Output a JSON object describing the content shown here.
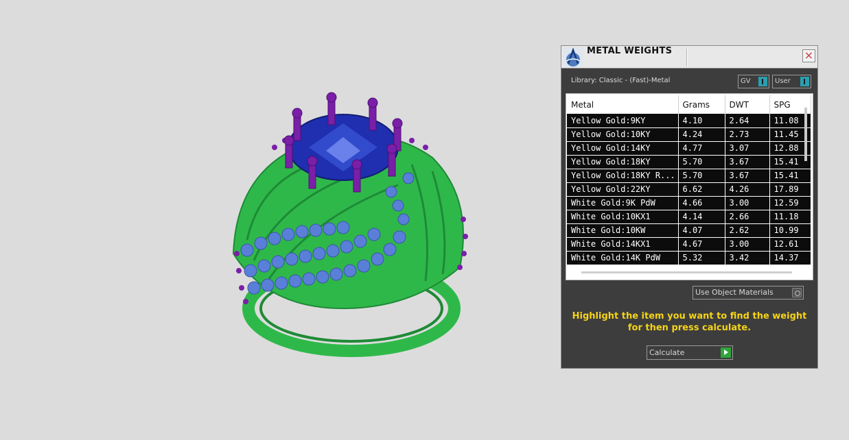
{
  "panel": {
    "title": "METAL WEIGHTS",
    "close_glyph": "×",
    "library_label": "Library: Classic - (Fast)-Metal",
    "toggle_gv_label": "GV",
    "toggle_user_label": "User"
  },
  "table": {
    "headers": [
      "Metal",
      "Grams",
      "DWT",
      "SPG"
    ],
    "rows": [
      [
        "Yellow Gold:9KY",
        "4.10",
        "2.64",
        "11.08"
      ],
      [
        "Yellow Gold:10KY",
        "4.24",
        "2.73",
        "11.45"
      ],
      [
        "Yellow Gold:14KY",
        "4.77",
        "3.07",
        "12.88"
      ],
      [
        "Yellow Gold:18KY",
        "5.70",
        "3.67",
        "15.41"
      ],
      [
        "Yellow Gold:18KY R...",
        "5.70",
        "3.67",
        "15.41"
      ],
      [
        "Yellow Gold:22KY",
        "6.62",
        "4.26",
        "17.89"
      ],
      [
        "White Gold:9K PdW",
        "4.66",
        "3.00",
        "12.59"
      ],
      [
        "White Gold:10KX1",
        "4.14",
        "2.66",
        "11.18"
      ],
      [
        "White Gold:10KW",
        "4.07",
        "2.62",
        "10.99"
      ],
      [
        "White Gold:14KX1",
        "4.67",
        "3.00",
        "12.61"
      ],
      [
        "White Gold:14K PdW",
        "5.32",
        "3.42",
        "14.37"
      ]
    ]
  },
  "materials_select": "Use Object Materials",
  "instructions": {
    "line1": "Highlight the item you want to find the weight",
    "line2": "for then press calculate."
  },
  "calculate_label": "Calculate",
  "colors": {
    "ring_metal": "#2fb84a",
    "center_stone": "#1f2fb0",
    "side_stones": "#5a7fd8",
    "prongs": "#7a1fa8",
    "instructions_text": "#f5d417",
    "toggle_accent": "#2a9fb0",
    "calculate_accent": "#2fa63a"
  }
}
